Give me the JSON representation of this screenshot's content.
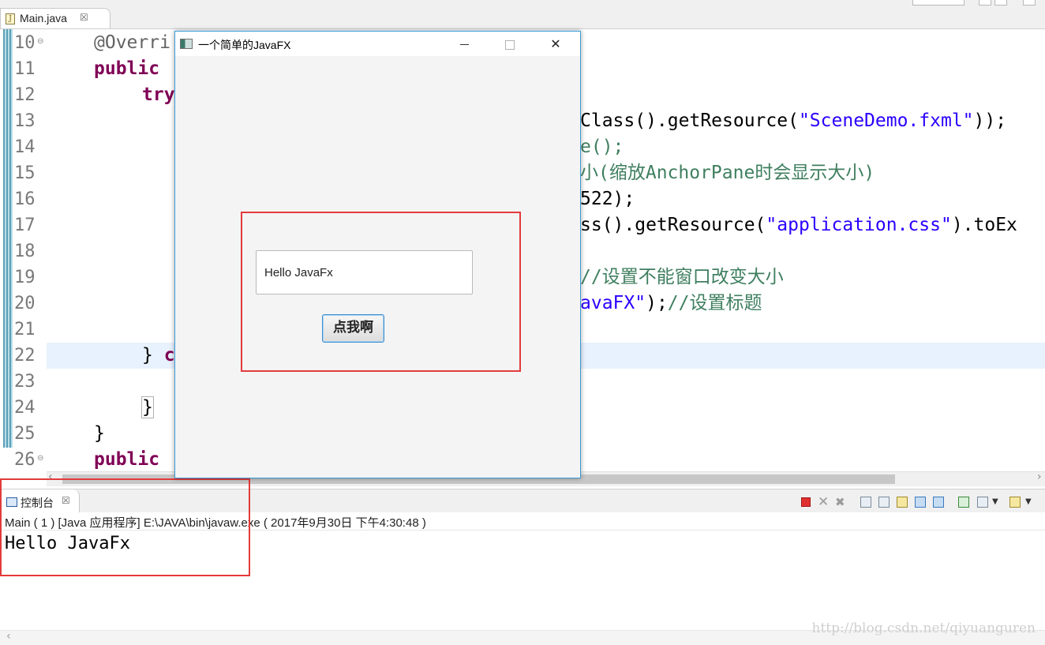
{
  "editor": {
    "tab_label": "Main.java",
    "tab_close": "☒",
    "line_numbers": [
      "10",
      "11",
      "12",
      "13",
      "14",
      "15",
      "16",
      "17",
      "18",
      "19",
      "20",
      "21",
      "22",
      "23",
      "24",
      "25",
      "26"
    ],
    "lines": {
      "l10": "@Overri",
      "l11_kw": "public",
      "l12_kw": "try",
      "l13_a": "Class().getResource(",
      "l13_str": "\"SceneDemo.fxml\"",
      "l13_b": "));",
      "l14_cm": "e();",
      "l15_cm": "小(缩放AnchorPane时会显示大小)",
      "l16": "522);",
      "l17_a": "ss().getResource(",
      "l17_str": "\"application.css\"",
      "l17_b": ").toEx",
      "l19_cm": "//设置不能窗口改变大小",
      "l20_str": "avaFX\"",
      "l20_b": ");",
      "l20_cm": "//设置标题",
      "l22_a": "} ",
      "l22_kw": "c",
      "l24": "}",
      "l25": "}",
      "l26_kw": "public"
    }
  },
  "fx_window": {
    "title": "一个简单的JavaFX",
    "minimize": "",
    "maximize": "",
    "close": "✕",
    "text_field_value": "Hello JavaFx",
    "button_label": "点我啊"
  },
  "console": {
    "tab_label": "控制台",
    "tab_close": "☒",
    "description": "Main ( 1 )  [Java 应用程序] E:\\JAVA\\bin\\javaw.exe ( 2017年9月30日 下午4:30:48 )",
    "output": "Hello JavaFx",
    "toolbar_icons": [
      "terminate-icon",
      "remove-launch-icon",
      "remove-all-icon",
      "clear-console-icon",
      "scroll-lock-icon",
      "word-wrap-icon",
      "show-on-stdout-icon",
      "show-on-stderr-icon",
      "pin-console-icon",
      "display-console-icon",
      "dropdown-icon",
      "open-console-icon",
      "dropdown-icon",
      "view-menu-icon"
    ]
  },
  "watermark": "http://blog.csdn.net/qiyuanguren",
  "colors": {
    "keyword": "#7f0055",
    "string": "#2a00ff",
    "comment": "#3f7f5f",
    "annotation_box": "#e33b3b",
    "window_border": "#3a9bd6"
  }
}
